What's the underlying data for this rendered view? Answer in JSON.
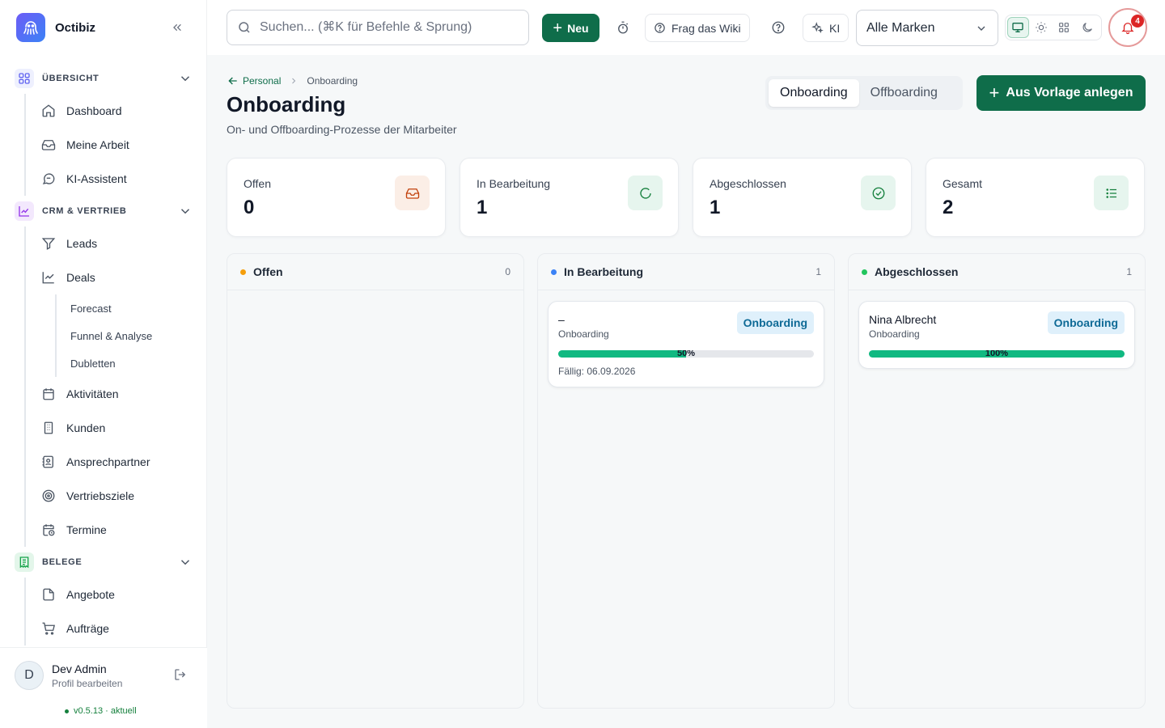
{
  "app": {
    "name": "Octibiz"
  },
  "sidebar": {
    "sections": [
      {
        "label": "ÜBERSICHT",
        "items": [
          "Dashboard",
          "Meine Arbeit",
          "KI-Assistent"
        ]
      },
      {
        "label": "CRM & VERTRIEB",
        "items": [
          "Leads",
          "Deals",
          "Aktivitäten",
          "Kunden",
          "Ansprechpartner",
          "Vertriebsziele",
          "Termine"
        ],
        "deal_subitems": [
          "Forecast",
          "Funnel & Analyse",
          "Dubletten"
        ]
      },
      {
        "label": "BELEGE",
        "items": [
          "Angebote",
          "Aufträge"
        ]
      }
    ],
    "user": {
      "initial": "D",
      "name": "Dev Admin",
      "profile_link": "Profil bearbeiten"
    },
    "version": "v0.5.13 · aktuell"
  },
  "topbar": {
    "search_placeholder": "Suchen... (⌘K für Befehle & Sprung)",
    "new_label": "Neu",
    "wiki_label": "Frag das Wiki",
    "ai_label": "KI",
    "brand_select": "Alle Marken",
    "notification_count": "4"
  },
  "page": {
    "breadcrumb_parent": "Personal",
    "breadcrumb_current": "Onboarding",
    "title": "Onboarding",
    "subtitle": "On- und Offboarding-Prozesse der Mitarbeiter",
    "tabs": [
      "Onboarding",
      "Offboarding"
    ],
    "active_tab": "Onboarding",
    "template_button": "Aus Vorlage anlegen"
  },
  "stats": [
    {
      "label": "Offen",
      "value": "0",
      "color": "#c2410c",
      "bg": "#fbeee6"
    },
    {
      "label": "In Bearbeitung",
      "value": "1",
      "color": "#15803d",
      "bg": "#e6f5ee"
    },
    {
      "label": "Abgeschlossen",
      "value": "1",
      "color": "#15803d",
      "bg": "#e6f5ee"
    },
    {
      "label": "Gesamt",
      "value": "2",
      "color": "#15803d",
      "bg": "#e6f5ee"
    }
  ],
  "columns": [
    {
      "title": "Offen",
      "count": "0",
      "color": "#f59e0b",
      "cards": []
    },
    {
      "title": "In Bearbeitung",
      "count": "1",
      "color": "#3b82f6",
      "cards": [
        {
          "name": "–",
          "type": "Onboarding",
          "badge": "Onboarding",
          "progress": 0.5,
          "progress_label": "50%",
          "due": "Fällig: 06.09.2026"
        }
      ]
    },
    {
      "title": "Abgeschlossen",
      "count": "1",
      "color": "#22c55e",
      "cards": [
        {
          "name": "Nina Albrecht",
          "type": "Onboarding",
          "badge": "Onboarding",
          "progress": 1.0,
          "progress_label": "100%"
        }
      ]
    }
  ],
  "colors": {
    "accent": "#0f6d4a",
    "danger": "#dc2626"
  }
}
